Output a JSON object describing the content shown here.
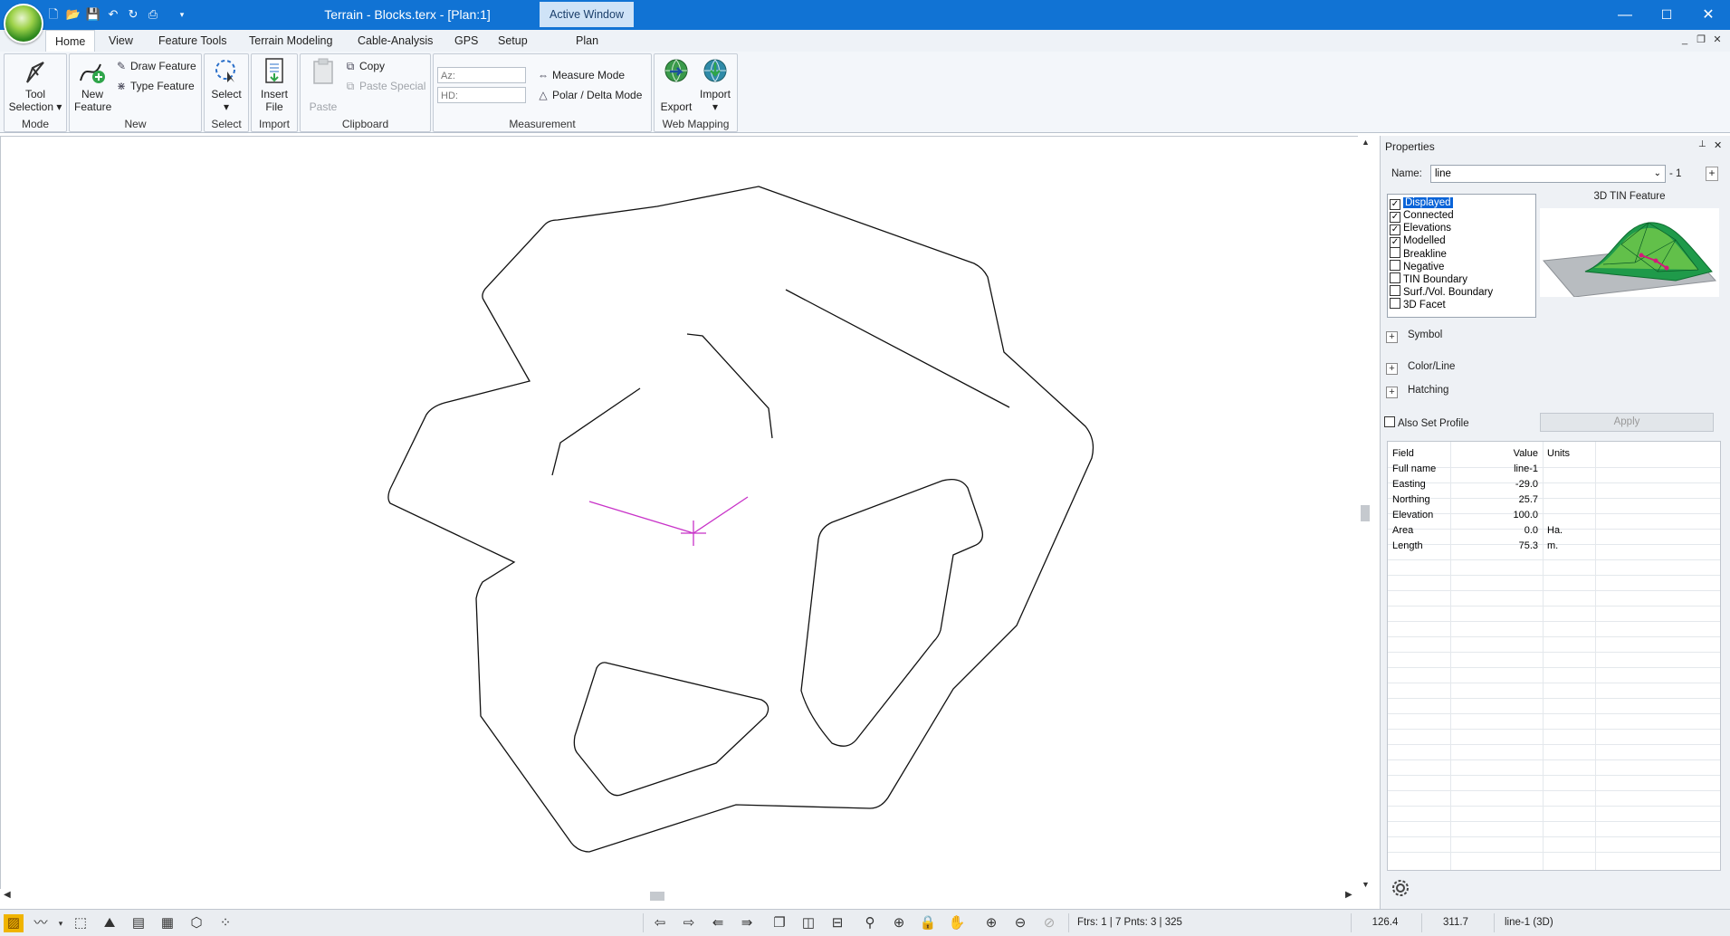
{
  "titlebar": {
    "title": "Terrain - Blocks.terx - [Plan:1]",
    "active_window": "Active Window",
    "minimize": "—",
    "maximize": "☐",
    "close": "✕"
  },
  "tabs": [
    "Home",
    "View",
    "Feature Tools",
    "Terrain Modeling",
    "Cable-Analysis",
    "GPS",
    "Setup",
    "Plan"
  ],
  "ribbon": {
    "tool_mode": {
      "label": "Tool Selection",
      "group": "Mode"
    },
    "new": {
      "new_feature": "New Feature",
      "draw_feature": "Draw Feature",
      "type_feature": "Type Feature",
      "group": "New"
    },
    "select": {
      "label": "Select",
      "group": "Select"
    },
    "import": {
      "label": "Insert File",
      "group": "Import"
    },
    "clipboard": {
      "paste": "Paste",
      "copy": "Copy",
      "paste_special": "Paste Special",
      "group": "Clipboard"
    },
    "measurement": {
      "az_placeholder": "Az:",
      "hd_placeholder": "HD:",
      "measure_mode": "Measure Mode",
      "polar_delta": "Polar / Delta Mode",
      "group": "Measurement"
    },
    "web_mapping": {
      "export": "Export",
      "import": "Import",
      "group": "Web Mapping"
    }
  },
  "properties": {
    "title": "Properties",
    "name_label": "Name:",
    "name_value": "line",
    "name_suffix": "- 1",
    "preview_title": "3D TIN Feature",
    "flags": [
      {
        "label": "Displayed",
        "checked": true,
        "selected": true
      },
      {
        "label": "Connected",
        "checked": true
      },
      {
        "label": "Elevations",
        "checked": true
      },
      {
        "label": "Modelled",
        "checked": true
      },
      {
        "label": "Breakline",
        "checked": false
      },
      {
        "label": "Negative",
        "checked": false
      },
      {
        "label": "TIN Boundary",
        "checked": false
      },
      {
        "label": "Surf./Vol. Boundary",
        "checked": false
      },
      {
        "label": "3D Facet",
        "checked": false
      }
    ],
    "sections": [
      "Symbol",
      "Color/Line",
      "Hatching"
    ],
    "also_set_profile": "Also Set Profile",
    "apply": "Apply",
    "grid_headers": [
      "Field",
      "Value",
      "Units"
    ],
    "grid_rows": [
      [
        "Full name",
        "line-1",
        ""
      ],
      [
        "Easting",
        "-29.0",
        ""
      ],
      [
        "Northing",
        "25.7",
        ""
      ],
      [
        "Elevation",
        "100.0",
        ""
      ],
      [
        "Area",
        "0.0",
        "Ha."
      ],
      [
        "Length",
        "75.3",
        "m."
      ]
    ]
  },
  "statusbar": {
    "features": "Ftrs: 1 | 7  Pnts: 3 | 325",
    "x": "126.4",
    "y": "311.7",
    "selection": "line-1 (3D)"
  },
  "colors": {
    "titlebar": "#1173d4",
    "selected_line": "#c832c8",
    "accent": "#0a64d8"
  }
}
